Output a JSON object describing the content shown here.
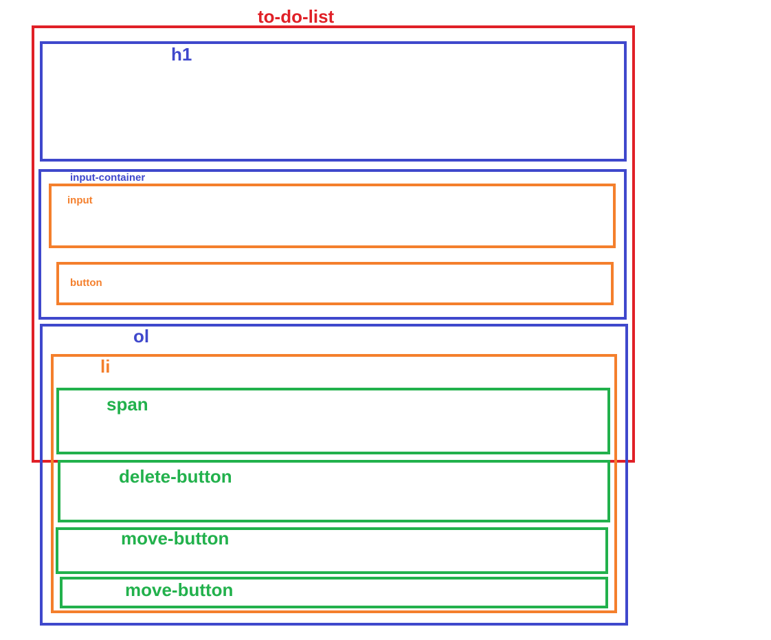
{
  "diagram": {
    "colors": {
      "red": "#e02027",
      "blue": "#3f48cc",
      "orange": "#f47f2c",
      "green": "#22b14c"
    },
    "boxes": {
      "todo_list": {
        "label": "to-do-list",
        "color": "#e02027"
      },
      "h1": {
        "label": "h1",
        "color": "#3f48cc"
      },
      "input_container": {
        "label": "input-container",
        "color": "#3f48cc"
      },
      "input": {
        "label": "input",
        "color": "#f47f2c"
      },
      "button": {
        "label": "button",
        "color": "#f47f2c"
      },
      "ol": {
        "label": "ol",
        "color": "#3f48cc"
      },
      "li": {
        "label": "li",
        "color": "#f47f2c"
      },
      "span": {
        "label": "span",
        "color": "#22b14c"
      },
      "delete_button": {
        "label": "delete-button",
        "color": "#22b14c"
      },
      "move_button_1": {
        "label": "move-button",
        "color": "#22b14c"
      },
      "move_button_2": {
        "label": "move-button",
        "color": "#22b14c"
      }
    }
  }
}
